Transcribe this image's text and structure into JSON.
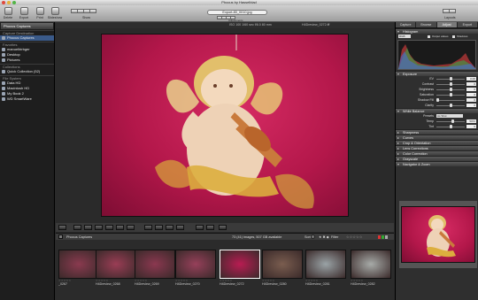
{
  "window": {
    "title": "Phocus by Hasselblad"
  },
  "toolbar": {
    "buttons": [
      {
        "label": "Delete",
        "icon": "trash-icon"
      },
      {
        "label": "Export",
        "icon": "export-icon"
      },
      {
        "label": "Print",
        "icon": "print-icon"
      },
      {
        "label": "Slideshow",
        "icon": "slideshow-icon"
      }
    ],
    "show_label": "Show",
    "file_field": "Export-80_0010.jpg",
    "adjustments_label": "Adjustments",
    "layouts_label": "Layouts"
  },
  "left_panel": {
    "source_selector": "Phocus Captures",
    "capture_destination_header": "Capture Destination",
    "capture_destination": "Phocus Captures",
    "favorites_header": "Favorites",
    "favorites": [
      "manuelbirbger",
      "Desktop",
      "Pictures"
    ],
    "collections_header": "Collections",
    "collections": [
      "Quick Collection (52)"
    ],
    "file_system_header": "File System",
    "file_system": [
      "Data HD",
      "Macintosh HD",
      "My Book 2",
      "WD SmartWare"
    ]
  },
  "viewer": {
    "info": "ISO 100   1/60 sec   f/6.0   80 mm",
    "filename": "H4Dreview_0272.fff"
  },
  "thumbnails": {
    "header_title": "Phocus Captures",
    "count_text": "73 (41) images, 507 GB available",
    "sort_label": "Sort",
    "filter_label": "Filter",
    "rating_placeholder": "☆☆☆☆☆",
    "items": [
      {
        "caption": "_0267",
        "color": "#8a3a4f"
      },
      {
        "caption": "H4Dreview_0268",
        "color": "#9a3d55"
      },
      {
        "caption": "H4Dreview_0269",
        "color": "#8b3850"
      },
      {
        "caption": "H4Dreview_0270",
        "color": "#96405a"
      },
      {
        "caption": "H4Dreview_0272",
        "color": "#b81c52"
      },
      {
        "caption": "H4Dreview_0280",
        "color": "#7a5d4f"
      },
      {
        "caption": "H4Dreview_0281",
        "color": "#9aa3a6"
      },
      {
        "caption": "H4Dreview_0282",
        "color": "#a7aba8"
      }
    ]
  },
  "right_panel": {
    "tabs": [
      "Capture",
      "Browse",
      "Adjust",
      "Export"
    ],
    "active_tab": "Adjust",
    "histogram": {
      "title": "Histogram",
      "channel": "RGB",
      "output_values_label": "Output values",
      "shadows_label": "Shadows"
    },
    "exposure": {
      "title": "Exposure",
      "rows": [
        {
          "label": "EV",
          "value": "0.00",
          "level": 0.5
        },
        {
          "label": "Contrast",
          "value": "0",
          "level": 0.5
        },
        {
          "label": "Brightness",
          "value": "0",
          "level": 0.5
        },
        {
          "label": "Saturation",
          "value": "0",
          "level": 0.5
        },
        {
          "label": "Shadow Fill",
          "value": "0",
          "level": 0.05
        },
        {
          "label": "Clarity",
          "value": "0",
          "level": 0.5
        }
      ]
    },
    "white_balance": {
      "title": "White Balance",
      "preset_label": "Presets",
      "preset_value": "As Shot",
      "temp_label": "Temp",
      "temp_value": "5072",
      "tint_label": "Tint",
      "tint_value": "0"
    },
    "sections": [
      "Sharpness",
      "Curves",
      "Crop & Orientation",
      "Lens Corrections",
      "Color Correction",
      "Grayscale",
      "Navigator & Zoom"
    ]
  },
  "colors": {
    "backdrop_red": "#c51e55",
    "selection_blue": "#3a5a89"
  }
}
